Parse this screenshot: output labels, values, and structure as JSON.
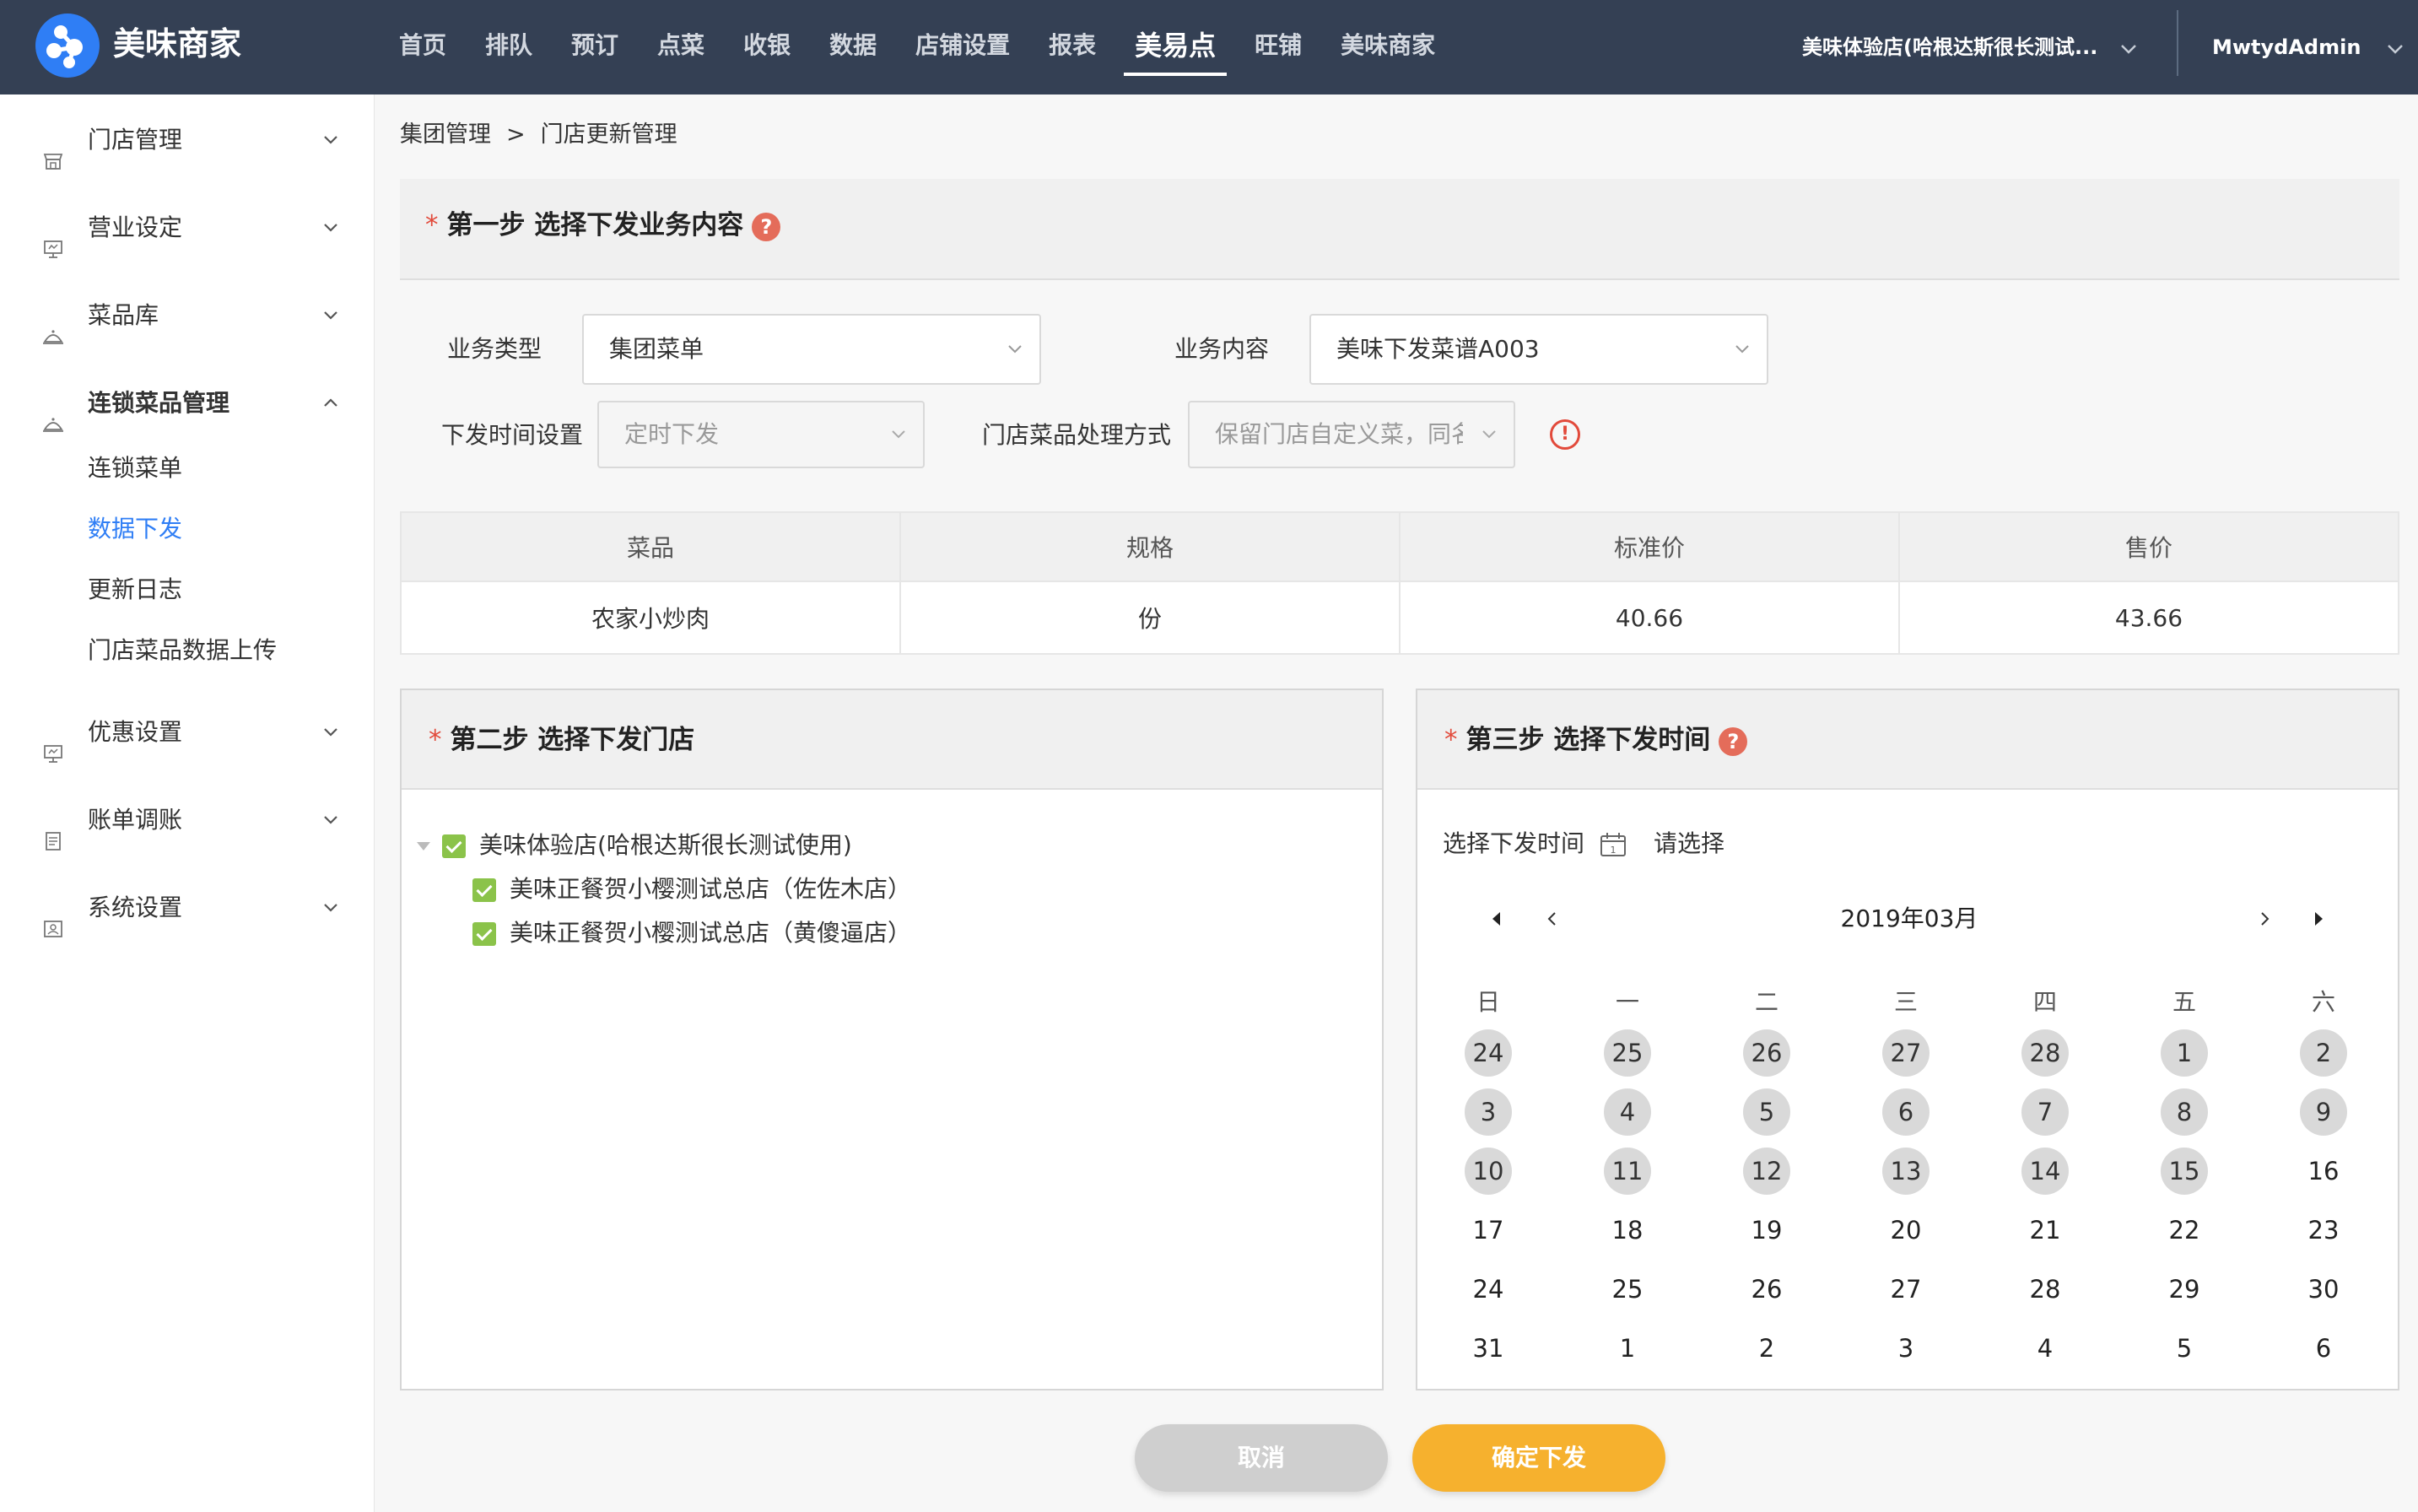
{
  "app": {
    "logo_text": "美味商家",
    "accent_color": "#2f7ef5"
  },
  "nav": {
    "items": [
      "首页",
      "排队",
      "预订",
      "点菜",
      "收银",
      "数据",
      "店铺设置",
      "报表",
      "美易点",
      "旺铺",
      "美味商家"
    ],
    "active": "美易点",
    "store": "美味体验店(哈根达斯很长测试...",
    "user": "MwtydAdmin"
  },
  "sidebar": {
    "groups": [
      {
        "label": "门店管理",
        "icon": "store-icon"
      },
      {
        "label": "营业设定",
        "icon": "monitor-icon"
      },
      {
        "label": "菜品库",
        "icon": "dish-cover-icon"
      },
      {
        "label": "连锁菜品管理",
        "icon": "dish-cover-icon",
        "expanded": true,
        "children": [
          "连锁菜单",
          "数据下发",
          "更新日志",
          "门店菜品数据上传"
        ],
        "active_child": "数据下发"
      },
      {
        "label": "优惠设置",
        "icon": "monitor-icon"
      },
      {
        "label": "账单调账",
        "icon": "document-icon"
      },
      {
        "label": "系统设置",
        "icon": "settings-panel-icon"
      }
    ]
  },
  "breadcrumb": {
    "parent": "集团管理",
    "separator": ">",
    "current": "门店更新管理"
  },
  "step1": {
    "title": "第一步  选择下发业务内容",
    "business_type_label": "业务类型",
    "business_type_value": "集团菜单",
    "business_content_label": "业务内容",
    "business_content_value": "美味下发菜谱A003",
    "time_setting_label": "下发时间设置",
    "time_setting_value": "定时下发",
    "dish_handling_label": "门店菜品处理方式",
    "dish_handling_value": "保留门店自定义菜，同名"
  },
  "table": {
    "headers": [
      "菜品",
      "规格",
      "标准价",
      "售价"
    ],
    "rows": [
      [
        "农家小炒肉",
        "份",
        "40.66",
        "43.66"
      ]
    ]
  },
  "step2": {
    "title": "第二步  选择下发门店",
    "root": "美味体验店(哈根达斯很长测试使用)",
    "children": [
      "美味正餐贺小樱测试总店（佐佐木店）",
      "美味正餐贺小樱测试总店（黄傻逼店）"
    ]
  },
  "step3": {
    "title": "第三步  选择下发时间",
    "time_label": "选择下发时间",
    "time_placeholder": "请选择",
    "month": "2019年03月",
    "weekdays": [
      "日",
      "一",
      "二",
      "三",
      "四",
      "五",
      "六"
    ],
    "weeks": [
      [
        "24",
        "25",
        "26",
        "27",
        "28",
        "1",
        "2"
      ],
      [
        "3",
        "4",
        "5",
        "6",
        "7",
        "8",
        "9"
      ],
      [
        "10",
        "11",
        "12",
        "13",
        "14",
        "15",
        "16"
      ],
      [
        "17",
        "18",
        "19",
        "20",
        "21",
        "22",
        "23"
      ],
      [
        "24",
        "25",
        "26",
        "27",
        "28",
        "29",
        "30"
      ],
      [
        "31",
        "1",
        "2",
        "3",
        "4",
        "5",
        "6"
      ]
    ],
    "disabled_count": 20
  },
  "buttons": {
    "cancel": "取消",
    "confirm": "确定下发"
  },
  "colors": {
    "topbar": "#344054",
    "confirm": "#f6b12e",
    "cancel": "#cfcfcf",
    "checkbox": "#8bc34a",
    "required": "#e24a3b"
  }
}
